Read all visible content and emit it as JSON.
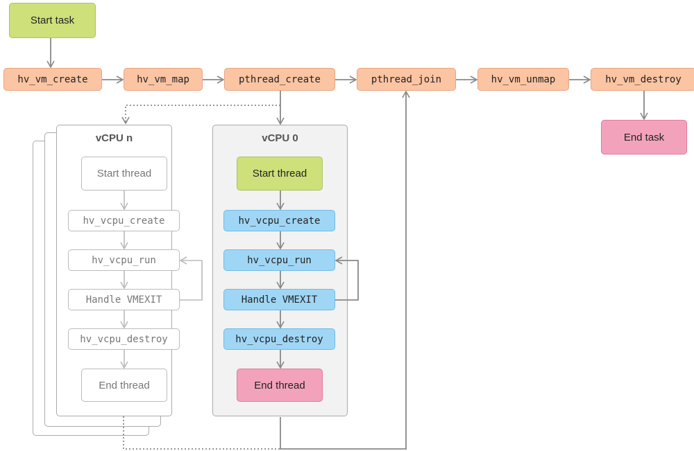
{
  "main_flow": {
    "start": "Start task",
    "steps": [
      "hv_vm_create",
      "hv_vm_map",
      "pthread_create",
      "pthread_join",
      "hv_vm_unmap",
      "hv_vm_destroy"
    ],
    "end": "End task"
  },
  "vcpu_n": {
    "title": "vCPU n",
    "start": "Start thread",
    "steps": [
      "hv_vcpu_create",
      "hv_vcpu_run",
      "Handle VMEXIT",
      "hv_vcpu_destroy"
    ],
    "end": "End thread"
  },
  "vcpu_0": {
    "title": "vCPU 0",
    "start": "Start thread",
    "steps": [
      "hv_vcpu_create",
      "hv_vcpu_run",
      "Handle VMEXIT",
      "hv_vcpu_destroy"
    ],
    "end": "End thread"
  },
  "colors": {
    "start": "#cde07a",
    "api": "#fbc4a2",
    "end": "#f2a3bb",
    "vcpu_api": "#a0d6f5",
    "panel": "#f2f2f2"
  }
}
